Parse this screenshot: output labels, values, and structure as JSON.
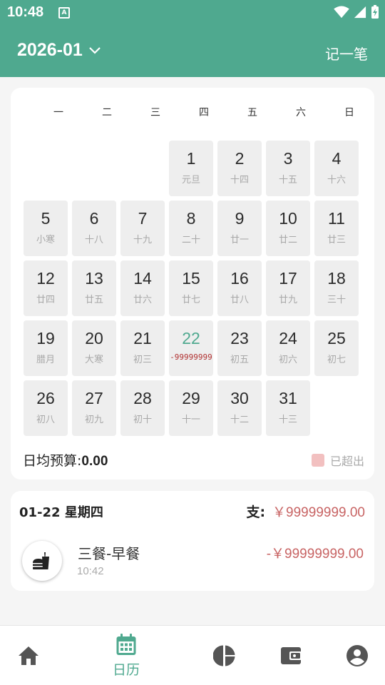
{
  "status_bar": {
    "time": "10:48",
    "a_icon": "A"
  },
  "app_bar": {
    "month": "2026-01",
    "record_label": "记一笔"
  },
  "calendar": {
    "weekdays": [
      "一",
      "二",
      "三",
      "四",
      "五",
      "六",
      "日"
    ],
    "days": [
      {
        "day": "1",
        "lunar": "元旦"
      },
      {
        "day": "2",
        "lunar": "十四"
      },
      {
        "day": "3",
        "lunar": "十五"
      },
      {
        "day": "4",
        "lunar": "十六"
      },
      {
        "day": "5",
        "lunar": "小寒"
      },
      {
        "day": "6",
        "lunar": "十八"
      },
      {
        "day": "7",
        "lunar": "十九"
      },
      {
        "day": "8",
        "lunar": "二十"
      },
      {
        "day": "9",
        "lunar": "廿一"
      },
      {
        "day": "10",
        "lunar": "廿二"
      },
      {
        "day": "11",
        "lunar": "廿三"
      },
      {
        "day": "12",
        "lunar": "廿四"
      },
      {
        "day": "13",
        "lunar": "廿五"
      },
      {
        "day": "14",
        "lunar": "廿六"
      },
      {
        "day": "15",
        "lunar": "廿七"
      },
      {
        "day": "16",
        "lunar": "廿八"
      },
      {
        "day": "17",
        "lunar": "廿九"
      },
      {
        "day": "18",
        "lunar": "三十"
      },
      {
        "day": "19",
        "lunar": "腊月"
      },
      {
        "day": "20",
        "lunar": "大寒"
      },
      {
        "day": "21",
        "lunar": "初三"
      },
      {
        "day": "22",
        "lunar": "-99999999",
        "today": true
      },
      {
        "day": "23",
        "lunar": "初五"
      },
      {
        "day": "24",
        "lunar": "初六"
      },
      {
        "day": "25",
        "lunar": "初七"
      },
      {
        "day": "26",
        "lunar": "初八"
      },
      {
        "day": "27",
        "lunar": "初九"
      },
      {
        "day": "28",
        "lunar": "初十"
      },
      {
        "day": "29",
        "lunar": "十一"
      },
      {
        "day": "30",
        "lunar": "十二"
      },
      {
        "day": "31",
        "lunar": "十三"
      }
    ],
    "budget_label": "日均预算:",
    "budget_value": "0.00",
    "over_label": "已超出"
  },
  "day_detail": {
    "date": "01-22  星期四",
    "expense_label": "支:",
    "expense_amount": "￥99999999.00",
    "transactions": [
      {
        "title": "三餐-早餐",
        "time": "10:42",
        "amount": "-￥99999999.00",
        "icon": "fast-food-icon"
      }
    ]
  },
  "tab_bar": {
    "active_label": "日历",
    "tabs": [
      "home-icon",
      "calendar-icon",
      "pie-chart-icon",
      "wallet-icon",
      "account-icon"
    ]
  },
  "colors": {
    "primary": "#4fa98f",
    "expense": "#c86464",
    "over_budget": "#f2c0c0"
  }
}
